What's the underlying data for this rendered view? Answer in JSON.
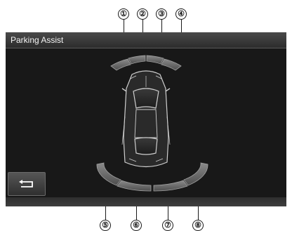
{
  "screen": {
    "title": "Parking Assist",
    "back_button": {
      "icon": "return-arrow-icon"
    }
  },
  "callouts": {
    "front": [
      "①",
      "②",
      "③",
      "④"
    ],
    "rear": [
      "⑤",
      "⑥",
      "⑦",
      "⑧"
    ]
  },
  "sensors": {
    "front": [
      {
        "number": "①",
        "zone": "front-left-corner"
      },
      {
        "number": "②",
        "zone": "front-left-center"
      },
      {
        "number": "③",
        "zone": "front-right-center"
      },
      {
        "number": "④",
        "zone": "front-right-corner"
      }
    ],
    "rear": [
      {
        "number": "⑤",
        "zone": "rear-left-corner"
      },
      {
        "number": "⑥",
        "zone": "rear-left-center"
      },
      {
        "number": "⑦",
        "zone": "rear-right-center"
      },
      {
        "number": "⑧",
        "zone": "rear-right-corner"
      }
    ]
  },
  "colors": {
    "screen_background": "#181818",
    "arc_fill": "#6e6e6e",
    "arc_edge": "#9a9a9a",
    "car_outline": "#cfcfcf"
  }
}
